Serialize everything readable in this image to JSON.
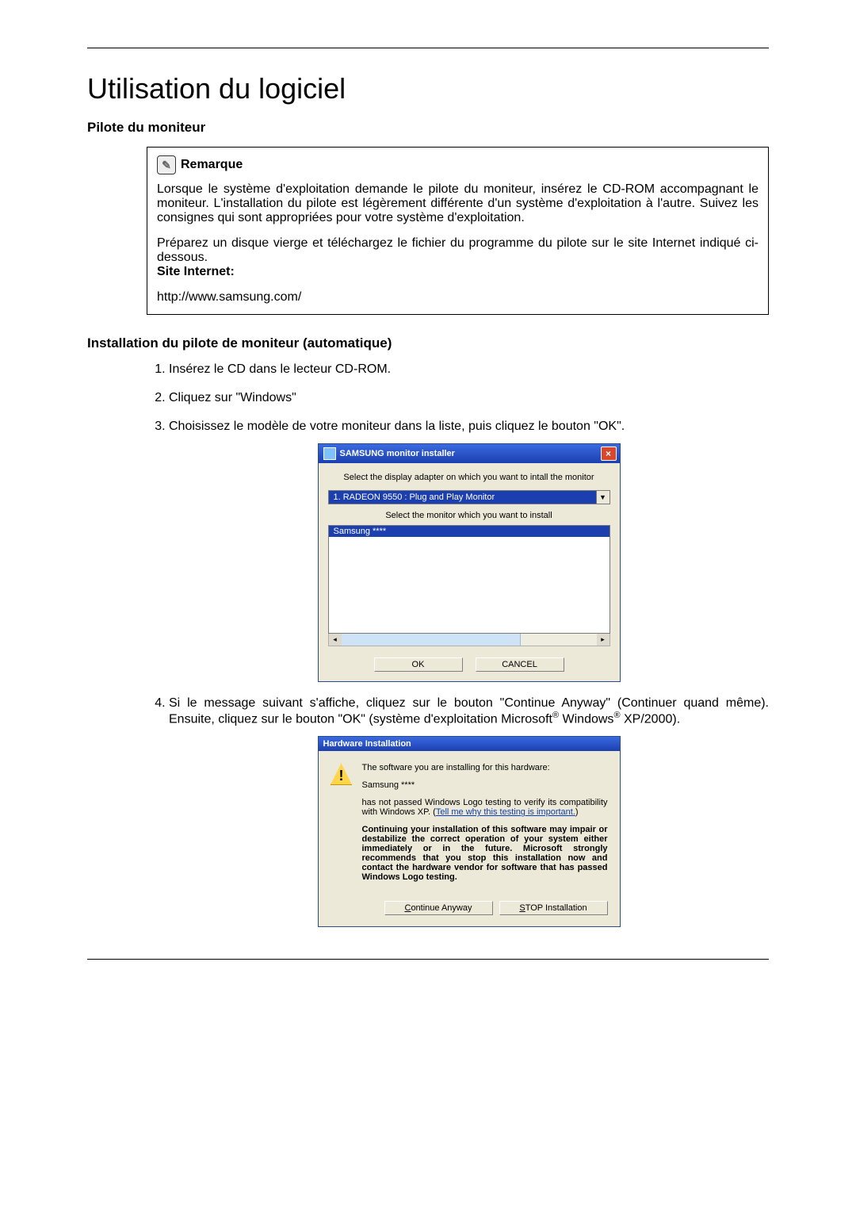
{
  "page": {
    "title": "Utilisation du logiciel",
    "section1": "Pilote du moniteur",
    "section2": "Installation du pilote de moniteur (automatique)"
  },
  "note": {
    "label": "Remarque",
    "p1": "Lorsque le système d'exploitation demande le pilote du moniteur, insérez le CD-ROM accompagnant le moniteur. L'installation du pilote est légèrement différente d'un système d'exploitation à l'autre. Suivez les consignes qui sont appropriées pour votre système d'exploitation.",
    "p2": "Préparez un disque vierge et téléchargez le fichier du programme du pilote sur le site Internet indiqué ci-dessous.",
    "site_label": "Site Internet:",
    "url": "http://www.samsung.com/"
  },
  "steps": {
    "s1": "Insérez le CD dans le lecteur CD-ROM.",
    "s2": "Cliquez sur \"Windows\"",
    "s3": "Choisissez le modèle de votre moniteur dans la liste, puis cliquez le bouton \"OK\".",
    "s4_part1": "Si le message suivant s'affiche, cliquez sur le bouton \"Continue Anyway\" (Continuer quand même). Ensuite, cliquez sur le bouton \"OK\" (système d'exploitation Microsoft",
    "s4_part2": " Windows",
    "s4_part3": " XP/2000)."
  },
  "installer": {
    "title": "SAMSUNG monitor installer",
    "label1": "Select the display adapter on which you want to intall the monitor",
    "dropdown_value": "1. RADEON 9550 : Plug and Play Monitor",
    "label2": "Select the monitor which you want to install",
    "list_selected": "Samsung ****",
    "ok": "OK",
    "cancel": "CANCEL"
  },
  "hw": {
    "title": "Hardware Installation",
    "line1": "The software you are installing for this hardware:",
    "device": "Samsung ****",
    "line2a": "has not passed Windows Logo testing to verify its compatibility with Windows XP. (",
    "link": "Tell me why this testing is important.",
    "line2b": ")",
    "bold": "Continuing your installation of this software may impair or destabilize the correct operation of your system either immediately or in the future. Microsoft strongly recommends that you stop this installation now and contact the hardware vendor for software that has passed Windows Logo testing.",
    "btn_continue_pre": "C",
    "btn_continue_rest": "ontinue Anyway",
    "btn_stop_pre": "S",
    "btn_stop_rest": "TOP Installation"
  }
}
